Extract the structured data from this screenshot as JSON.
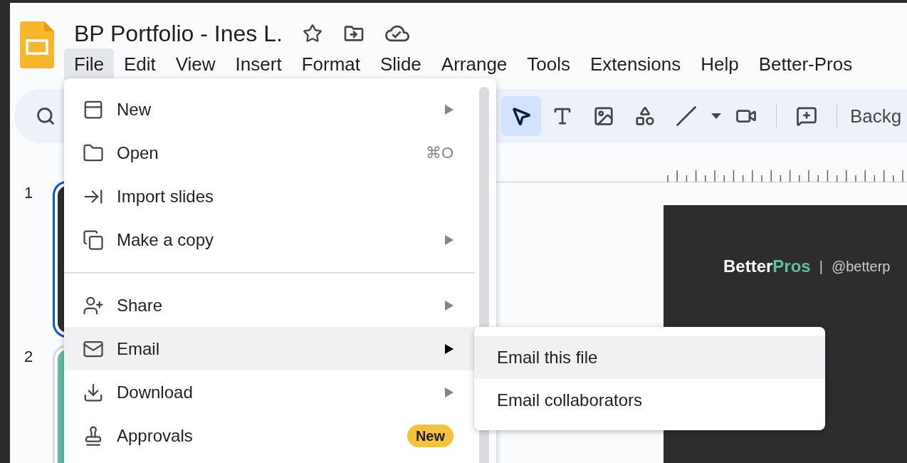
{
  "document": {
    "title": "BP Portfolio - Ines L."
  },
  "menu_bar": [
    {
      "label": "File",
      "selected": true
    },
    {
      "label": "Edit",
      "selected": false
    },
    {
      "label": "View",
      "selected": false
    },
    {
      "label": "Insert",
      "selected": false
    },
    {
      "label": "Format",
      "selected": false
    },
    {
      "label": "Slide",
      "selected": false
    },
    {
      "label": "Arrange",
      "selected": false
    },
    {
      "label": "Tools",
      "selected": false
    },
    {
      "label": "Extensions",
      "selected": false
    },
    {
      "label": "Help",
      "selected": false
    },
    {
      "label": "Better-Pros",
      "selected": false
    }
  ],
  "toolbar": {
    "tools": [
      {
        "kind": "pointer",
        "selected": true
      },
      {
        "kind": "text",
        "selected": false
      },
      {
        "kind": "image",
        "selected": false
      },
      {
        "kind": "shapes",
        "selected": false
      },
      {
        "kind": "line",
        "selected": false
      },
      {
        "kind": "caret"
      },
      {
        "kind": "video",
        "selected": false
      },
      {
        "kind": "separator"
      },
      {
        "kind": "comment",
        "selected": false
      },
      {
        "kind": "separator"
      }
    ],
    "background_button": "Backg"
  },
  "slides": [
    {
      "number": "1",
      "selected": true,
      "color": "#2d2d2d"
    },
    {
      "number": "2",
      "selected": false,
      "color": "#5fbfa4"
    }
  ],
  "canvas": {
    "logo_first": "Better",
    "logo_second": "Pros",
    "separator": "|",
    "handle": "@betterp"
  },
  "file_menu": [
    {
      "kind": "item",
      "label": "New",
      "submenu": true,
      "highlighted": false
    },
    {
      "kind": "item",
      "label": "Open",
      "shortcut": "⌘O",
      "submenu": false,
      "highlighted": false
    },
    {
      "kind": "item",
      "label": "Import slides",
      "submenu": false,
      "highlighted": false
    },
    {
      "kind": "item",
      "label": "Make a copy",
      "submenu": true,
      "highlighted": false
    },
    {
      "kind": "divider"
    },
    {
      "kind": "item",
      "label": "Share",
      "submenu": true,
      "highlighted": false
    },
    {
      "kind": "item",
      "label": "Email",
      "submenu": true,
      "highlighted": true
    },
    {
      "kind": "item",
      "label": "Download",
      "submenu": true,
      "highlighted": false
    },
    {
      "kind": "item",
      "label": "Approvals",
      "badge": "New",
      "submenu": false,
      "highlighted": false
    }
  ],
  "email_submenu": [
    {
      "label": "Email this file",
      "highlighted": true
    },
    {
      "label": "Email collaborators",
      "highlighted": false
    }
  ]
}
